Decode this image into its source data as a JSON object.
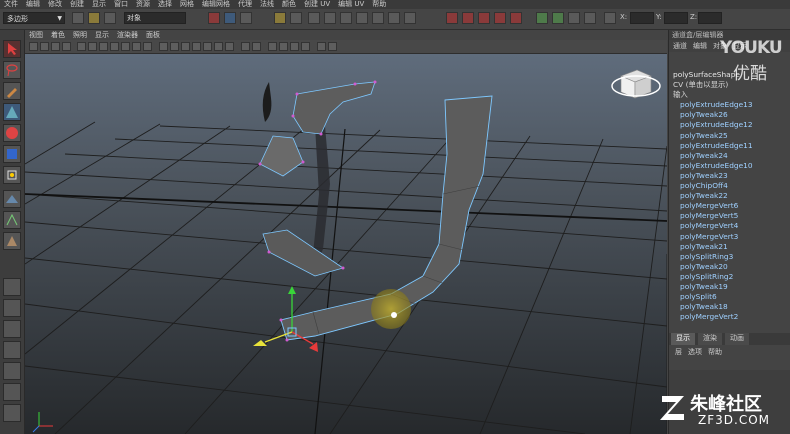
{
  "menubar": {
    "items": [
      "文件",
      "编辑",
      "修改",
      "创建",
      "显示",
      "窗口",
      "资源",
      "选择",
      "网格",
      "编辑网格",
      "代理",
      "法线",
      "颜色",
      "创建 UV",
      "编辑 UV",
      "帮助"
    ]
  },
  "toolbar": {
    "mode_select": "多边形",
    "object_field": "对象",
    "x_label": "X:",
    "y_label": "Y:",
    "z_label": "Z:"
  },
  "panel": {
    "menu": [
      "视图",
      "着色",
      "照明",
      "显示",
      "渲染器",
      "面板"
    ]
  },
  "channel_box": {
    "header": "通道盒/层编辑器",
    "tabs": [
      "通道",
      "编辑",
      "对象",
      "显示"
    ],
    "shape_name": "polySurfaceShape",
    "shape_sub": "CV (单击以显示)",
    "inputs_label": "输入",
    "nodes": [
      "polyExtrudeEdge13",
      "polyTweak26",
      "polyExtrudeEdge12",
      "polyTweak25",
      "polyExtrudeEdge11",
      "polyTweak24",
      "polyExtrudeEdge10",
      "polyTweak23",
      "polyChipOff4",
      "polyTweak22",
      "polyMergeVert6",
      "polyMergeVert5",
      "polyMergeVert4",
      "polyMergeVert3",
      "polyTweak21",
      "polySplitRing3",
      "polyTweak20",
      "polySplitRing2",
      "polyTweak19",
      "polySplit6",
      "polyTweak18",
      "polyMergeVert2"
    ]
  },
  "layer_editor": {
    "tabs": [
      "显示",
      "渲染",
      "动画"
    ],
    "menu": [
      "层",
      "选项",
      "帮助"
    ]
  },
  "watermarks": {
    "youku": "YOUKU",
    "youku_cn": "优酷",
    "zf_cn": "朱峰社区",
    "zf_en": "ZF3D.COM"
  },
  "colors": {
    "viewport_top": "#5f6c7c",
    "viewport_bottom": "#26292c",
    "grid": "#1e1e1e",
    "mesh_fill": "#5d5d5d",
    "wire_highlight": "#7ec8ff",
    "vertex": "#d05bd0"
  },
  "icons": [
    "select-arrow-icon",
    "lasso-icon",
    "paint-select-icon",
    "move-icon",
    "rotate-icon",
    "scale-icon",
    "view-cube-icon",
    "axis-indicator-icon",
    "move-manipulator-icon",
    "soft-select-falloff-icon"
  ]
}
